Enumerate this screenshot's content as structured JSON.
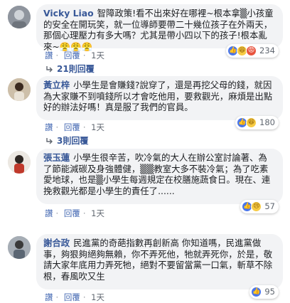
{
  "comments": [
    {
      "name": "Vicky Liao",
      "text": "智障政策!看不出來好在哪裡~根本拿▒小孩童的安全在開玩笑，就一位導師要帶二十幾位孩子在外兩天，那個心理壓力有多大嗎？尤其是帶小四以下的孩子!根本亂來~😤😤😤",
      "reaction_count": "234",
      "reactions": [
        "like-reaction-icon",
        "haha-reaction-icon",
        "angry-reaction-icon"
      ],
      "actions": {
        "like": "讚",
        "reply": "回覆",
        "time": "1天"
      },
      "replies": "21則回覆"
    },
    {
      "name": "黃立梓",
      "text": "小學生是會賺錢?說穿了，還是再挖父母的錢，就因為大家賺不到噴錢所以才會吃他用，要救觀光，麻煩是出點好的辦法好嗎！真是服了我們的官員。",
      "reaction_count": "180",
      "reactions": [
        "like-reaction-icon",
        "haha-reaction-icon"
      ],
      "actions": {
        "like": "讚",
        "reply": "回覆",
        "time": "1天"
      },
      "replies": "3則回覆"
    },
    {
      "name": "張玉蓮",
      "text": "小學生很辛苦，吹冷氣的大人在辦公室討論著、為了節能減碳及身強體健，▒▒教室大多不裝冷氣；為了吃素愛地球，也是▒小學生每週規定在校膳施蔬食日。現在、連挽救觀光都是小學生的責任了......",
      "reaction_count": "57",
      "reactions": [
        "like-reaction-icon",
        "sad-reaction-icon"
      ],
      "actions": {
        "like": "讚",
        "reply": "回覆",
        "time": "1天"
      },
      "replies": ""
    },
    {
      "name": "謝合政",
      "text": "民進黨的奇葩指數再創新高 你知道嗎，民進黨做事，夠狠夠絕夠無賴，你不弄死他，牠就弄死你，於是，敬請大家年底用力弄死牠，絕對不要留當黨一口氣，斬草不除根，春風吹又生",
      "reaction_count": "95",
      "reactions": [
        "like-reaction-icon"
      ],
      "actions": {
        "like": "讚",
        "reply": "回覆",
        "time": "1天"
      },
      "replies": ""
    }
  ]
}
